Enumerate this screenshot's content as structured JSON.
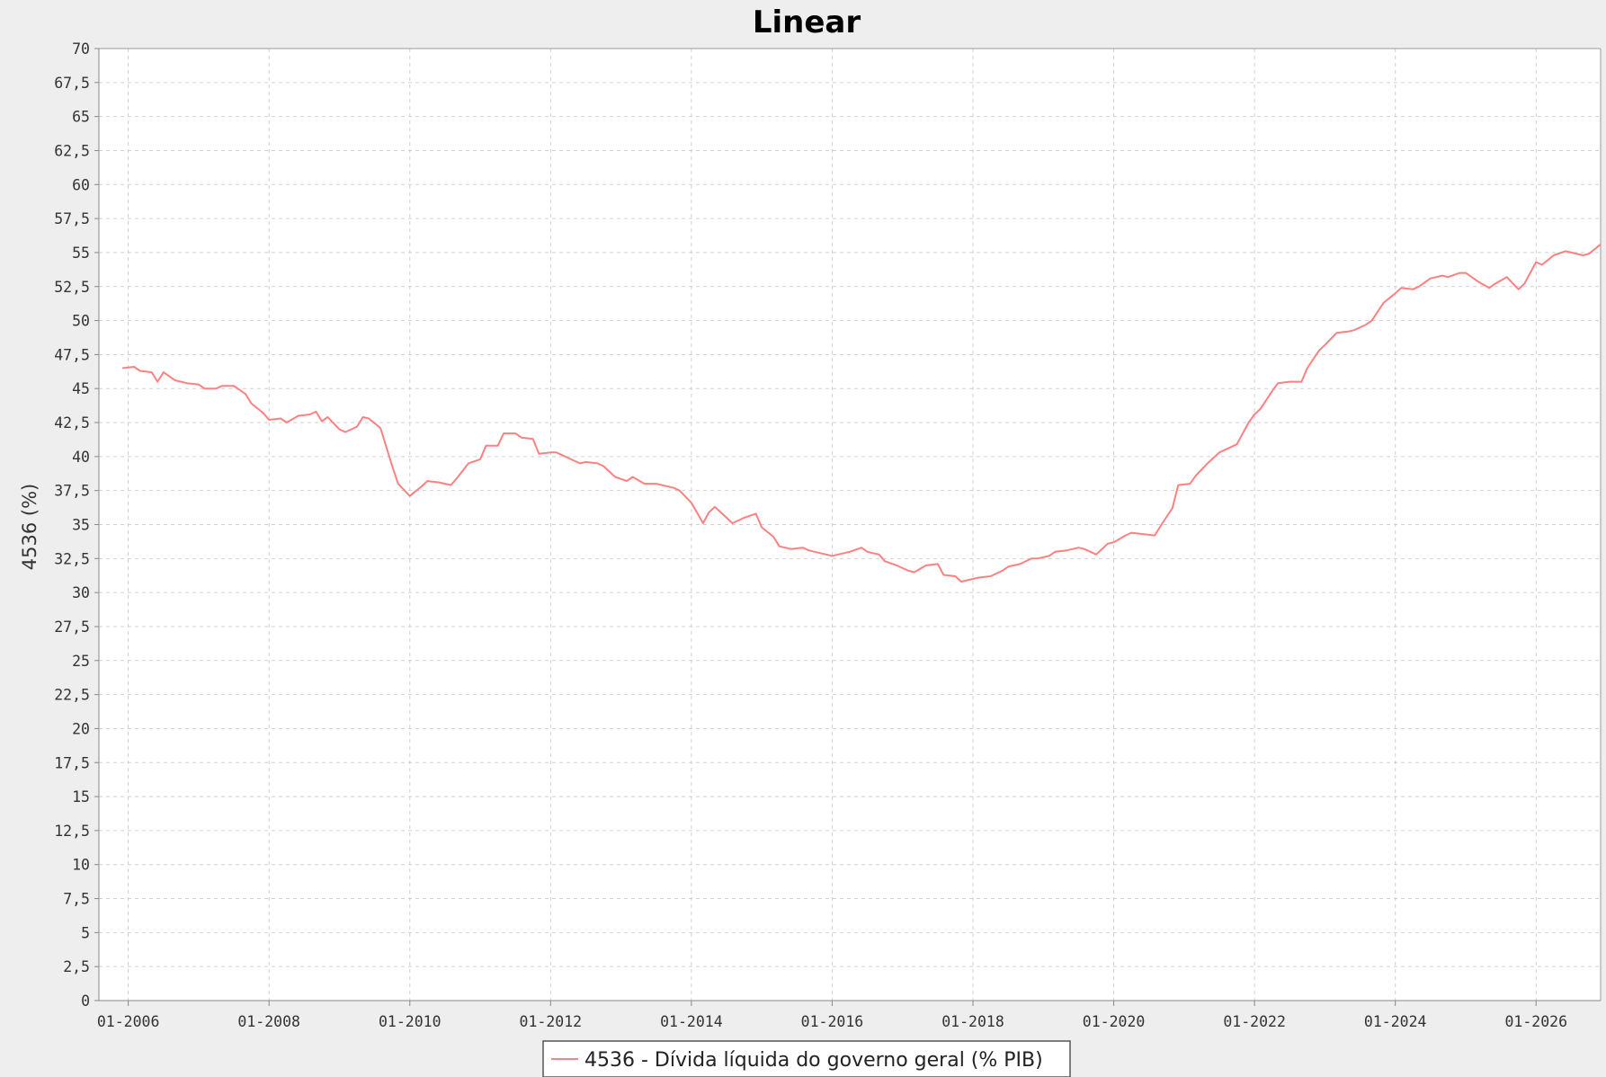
{
  "chart_data": {
    "type": "line",
    "title": "Linear",
    "xlabel": "",
    "ylabel": "4536 (%)",
    "ylim": [
      0,
      70
    ],
    "xlim": [
      "2005-08",
      "2026-12"
    ],
    "yticks": [
      "0",
      "2,5",
      "5",
      "7,5",
      "10",
      "12,5",
      "15",
      "17,5",
      "20",
      "22,5",
      "25",
      "27,5",
      "30",
      "32,5",
      "35",
      "37,5",
      "40",
      "42,5",
      "45",
      "47,5",
      "50",
      "52,5",
      "55",
      "57,5",
      "60",
      "62,5",
      "65",
      "67,5",
      "70"
    ],
    "xticks": [
      "01-2006",
      "01-2008",
      "01-2010",
      "01-2012",
      "01-2014",
      "01-2016",
      "01-2018",
      "01-2020",
      "01-2022",
      "01-2024",
      "01-2026"
    ],
    "legend_position": "bottom",
    "grid": true,
    "colors": {
      "series": "#ff8080",
      "plot_bg": "#ffffff",
      "page_bg": "#eeeeee"
    },
    "series": [
      {
        "name": "4536 - Dívida líquida do governo geral (% PIB)",
        "points": [
          [
            "2005-12",
            46.5
          ],
          [
            "2006-02",
            46.6
          ],
          [
            "2006-03",
            46.3
          ],
          [
            "2006-05",
            46.2
          ],
          [
            "2006-06",
            45.5
          ],
          [
            "2006-07",
            46.2
          ],
          [
            "2006-09",
            45.6
          ],
          [
            "2006-11",
            45.4
          ],
          [
            "2007-01",
            45.3
          ],
          [
            "2007-02",
            45.0
          ],
          [
            "2007-04",
            45.0
          ],
          [
            "2007-05",
            45.2
          ],
          [
            "2007-07",
            45.2
          ],
          [
            "2007-09",
            44.6
          ],
          [
            "2007-10",
            43.9
          ],
          [
            "2007-12",
            43.2
          ],
          [
            "2008-01",
            42.7
          ],
          [
            "2008-03",
            42.8
          ],
          [
            "2008-04",
            42.5
          ],
          [
            "2008-06",
            43.0
          ],
          [
            "2008-08",
            43.1
          ],
          [
            "2008-09",
            43.3
          ],
          [
            "2008-10",
            42.6
          ],
          [
            "2008-11",
            42.9
          ],
          [
            "2009-01",
            42.0
          ],
          [
            "2009-02",
            41.8
          ],
          [
            "2009-04",
            42.2
          ],
          [
            "2009-05",
            42.9
          ],
          [
            "2009-06",
            42.8
          ],
          [
            "2009-08",
            42.1
          ],
          [
            "2009-10",
            39.3
          ],
          [
            "2009-11",
            38.0
          ],
          [
            "2010-01",
            37.1
          ],
          [
            "2010-03",
            37.8
          ],
          [
            "2010-04",
            38.2
          ],
          [
            "2010-06",
            38.1
          ],
          [
            "2010-08",
            37.9
          ],
          [
            "2010-09",
            38.4
          ],
          [
            "2010-11",
            39.5
          ],
          [
            "2011-01",
            39.8
          ],
          [
            "2011-02",
            40.8
          ],
          [
            "2011-04",
            40.8
          ],
          [
            "2011-05",
            41.7
          ],
          [
            "2011-07",
            41.7
          ],
          [
            "2011-08",
            41.4
          ],
          [
            "2011-10",
            41.3
          ],
          [
            "2011-11",
            40.2
          ],
          [
            "2012-01",
            40.3
          ],
          [
            "2012-02",
            40.3
          ],
          [
            "2012-04",
            39.9
          ],
          [
            "2012-06",
            39.5
          ],
          [
            "2012-07",
            39.6
          ],
          [
            "2012-09",
            39.5
          ],
          [
            "2012-10",
            39.3
          ],
          [
            "2012-12",
            38.5
          ],
          [
            "2013-02",
            38.2
          ],
          [
            "2013-03",
            38.5
          ],
          [
            "2013-05",
            38.0
          ],
          [
            "2013-07",
            38.0
          ],
          [
            "2013-08",
            37.9
          ],
          [
            "2013-10",
            37.7
          ],
          [
            "2013-11",
            37.5
          ],
          [
            "2014-01",
            36.6
          ],
          [
            "2014-03",
            35.1
          ],
          [
            "2014-04",
            35.9
          ],
          [
            "2014-05",
            36.3
          ],
          [
            "2014-07",
            35.5
          ],
          [
            "2014-08",
            35.1
          ],
          [
            "2014-10",
            35.5
          ],
          [
            "2014-12",
            35.8
          ],
          [
            "2015-01",
            34.8
          ],
          [
            "2015-03",
            34.1
          ],
          [
            "2015-04",
            33.4
          ],
          [
            "2015-06",
            33.2
          ],
          [
            "2015-08",
            33.3
          ],
          [
            "2015-09",
            33.1
          ],
          [
            "2015-11",
            32.9
          ],
          [
            "2016-01",
            32.7
          ],
          [
            "2016-02",
            32.8
          ],
          [
            "2016-04",
            33.0
          ],
          [
            "2016-06",
            33.3
          ],
          [
            "2016-07",
            33.0
          ],
          [
            "2016-09",
            32.8
          ],
          [
            "2016-10",
            32.3
          ],
          [
            "2016-12",
            32.0
          ],
          [
            "2017-02",
            31.6
          ],
          [
            "2017-03",
            31.5
          ],
          [
            "2017-05",
            32.0
          ],
          [
            "2017-07",
            32.1
          ],
          [
            "2017-08",
            31.3
          ],
          [
            "2017-10",
            31.2
          ],
          [
            "2017-11",
            30.8
          ],
          [
            "2018-01",
            31.0
          ],
          [
            "2018-02",
            31.1
          ],
          [
            "2018-04",
            31.2
          ],
          [
            "2018-06",
            31.6
          ],
          [
            "2018-07",
            31.9
          ],
          [
            "2018-09",
            32.1
          ],
          [
            "2018-11",
            32.5
          ],
          [
            "2018-12",
            32.5
          ],
          [
            "2019-02",
            32.7
          ],
          [
            "2019-03",
            33.0
          ],
          [
            "2019-05",
            33.1
          ],
          [
            "2019-07",
            33.3
          ],
          [
            "2019-08",
            33.2
          ],
          [
            "2019-10",
            32.8
          ],
          [
            "2019-12",
            33.6
          ],
          [
            "2020-01",
            33.7
          ],
          [
            "2020-03",
            34.2
          ],
          [
            "2020-04",
            34.4
          ],
          [
            "2020-06",
            34.3
          ],
          [
            "2020-08",
            34.2
          ],
          [
            "2020-09",
            34.9
          ],
          [
            "2020-11",
            36.2
          ],
          [
            "2020-12",
            37.9
          ],
          [
            "2021-02",
            38.0
          ],
          [
            "2021-03",
            38.6
          ],
          [
            "2021-05",
            39.5
          ],
          [
            "2021-07",
            40.3
          ],
          [
            "2021-08",
            40.5
          ],
          [
            "2021-10",
            40.9
          ],
          [
            "2021-12",
            42.5
          ],
          [
            "2022-01",
            43.1
          ],
          [
            "2022-02",
            43.5
          ],
          [
            "2022-04",
            44.8
          ],
          [
            "2022-05",
            45.4
          ],
          [
            "2022-07",
            45.5
          ],
          [
            "2022-09",
            45.5
          ],
          [
            "2022-10",
            46.5
          ],
          [
            "2022-12",
            47.8
          ],
          [
            "2023-01",
            48.2
          ],
          [
            "2023-03",
            49.1
          ],
          [
            "2023-05",
            49.2
          ],
          [
            "2023-06",
            49.3
          ],
          [
            "2023-08",
            49.7
          ],
          [
            "2023-09",
            50.0
          ],
          [
            "2023-11",
            51.3
          ],
          [
            "2024-01",
            52.0
          ],
          [
            "2024-02",
            52.4
          ],
          [
            "2024-04",
            52.3
          ],
          [
            "2024-05",
            52.5
          ],
          [
            "2024-07",
            53.1
          ],
          [
            "2024-09",
            53.3
          ],
          [
            "2024-10",
            53.2
          ],
          [
            "2024-12",
            53.5
          ],
          [
            "2025-01",
            53.5
          ],
          [
            "2025-03",
            52.9
          ],
          [
            "2025-05",
            52.4
          ],
          [
            "2025-06",
            52.7
          ],
          [
            "2025-08",
            53.2
          ],
          [
            "2025-10",
            52.3
          ],
          [
            "2025-11",
            52.7
          ],
          [
            "2026-01",
            54.3
          ],
          [
            "2026-02",
            54.1
          ],
          [
            "2026-04",
            54.8
          ],
          [
            "2026-06",
            55.1
          ],
          [
            "2026-07",
            55.0
          ],
          [
            "2026-09",
            54.8
          ],
          [
            "2026-10",
            54.9
          ],
          [
            "2026-12",
            55.6
          ]
        ]
      }
    ]
  }
}
